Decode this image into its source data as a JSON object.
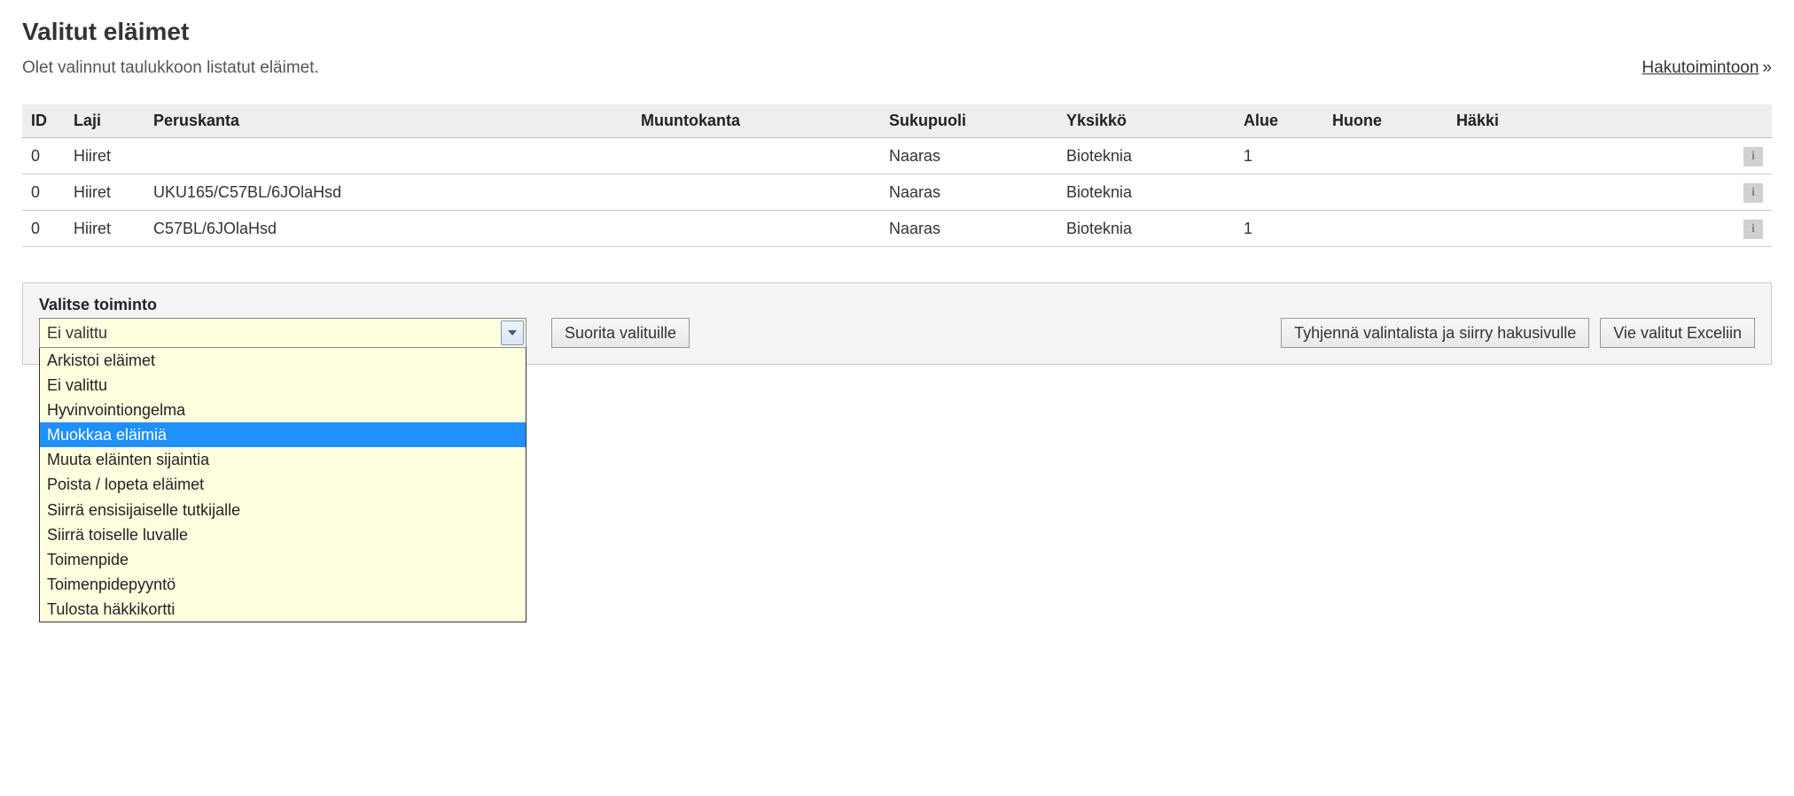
{
  "header": {
    "title": "Valitut eläimet",
    "subtitle": "Olet valinnut taulukkoon listatut eläimet.",
    "nav_link": "Hakutoimintoon"
  },
  "table": {
    "columns": [
      "ID",
      "Laji",
      "Peruskanta",
      "Muuntokanta",
      "Sukupuoli",
      "Yksikkö",
      "Alue",
      "Huone",
      "Häkki"
    ],
    "rows": [
      {
        "id": "0",
        "laji": "Hiiret",
        "peruskanta": "",
        "muuntokanta": "",
        "sukupuoli": "Naaras",
        "yksikko": "Bioteknia",
        "alue": "1",
        "huone": "",
        "hakki": ""
      },
      {
        "id": "0",
        "laji": "Hiiret",
        "peruskanta": "UKU165/C57BL/6JOlaHsd",
        "muuntokanta": "",
        "sukupuoli": "Naaras",
        "yksikko": "Bioteknia",
        "alue": "",
        "huone": "",
        "hakki": ""
      },
      {
        "id": "0",
        "laji": "Hiiret",
        "peruskanta": "C57BL/6JOlaHsd",
        "muuntokanta": "",
        "sukupuoli": "Naaras",
        "yksikko": "Bioteknia",
        "alue": "1",
        "huone": "",
        "hakki": ""
      }
    ]
  },
  "action_panel": {
    "label": "Valitse toiminto",
    "selected_value": "Ei valittu",
    "options": [
      "Arkistoi eläimet",
      "Ei valittu",
      "Hyvinvointiongelma",
      "Muokkaa eläimiä",
      "Muuta eläinten sijaintia",
      "Poista / lopeta eläimet",
      "Siirrä ensisijaiselle tutkijalle",
      "Siirrä toiselle luvalle",
      "Toimenpide",
      "Toimenpidepyyntö",
      "Tulosta häkkikortti"
    ],
    "highlighted_option_index": 3
  },
  "buttons": {
    "execute": "Suorita valituille",
    "clear_and_goto_search": "Tyhjennä valintalista ja siirry hakusivulle",
    "export_excel": "Vie valitut Exceliin"
  },
  "icons": {
    "info_glyph": "i"
  }
}
